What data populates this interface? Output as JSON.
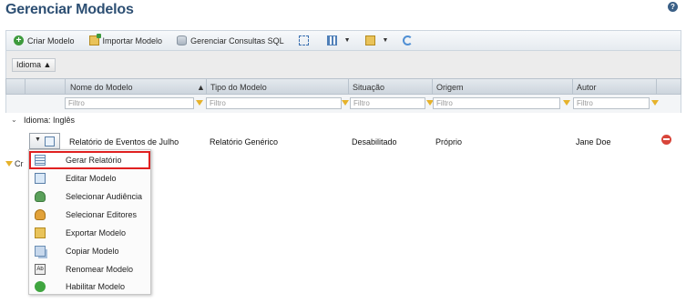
{
  "page": {
    "title": "Gerenciar Modelos"
  },
  "toolbar": {
    "create_label": "Criar Modelo",
    "import_label": "Importar Modelo",
    "sql_label": "Gerenciar Consultas SQL"
  },
  "grouping": {
    "chip_label": "Idioma"
  },
  "columns": {
    "name": "Nome do Modelo",
    "type": "Tipo do Modelo",
    "status": "Situação",
    "origin": "Origem",
    "author": "Autor"
  },
  "filter": {
    "placeholder": "Filtro"
  },
  "group": {
    "label": "Idioma: Inglês"
  },
  "row": {
    "name": "Relatório de Eventos de Julho",
    "type": "Relatório Genérico",
    "status": "Desabilitado",
    "origin": "Próprio",
    "author": "Jane Doe"
  },
  "footer": {
    "label": "Cr"
  },
  "context_menu": {
    "items": [
      {
        "label": "Gerar Relatório",
        "icon": "report-icon"
      },
      {
        "label": "Editar Modelo",
        "icon": "edit-icon"
      },
      {
        "label": "Selecionar Audiência",
        "icon": "audience-icon"
      },
      {
        "label": "Selecionar Editores",
        "icon": "editors-icon"
      },
      {
        "label": "Exportar Modelo",
        "icon": "export-icon"
      },
      {
        "label": "Copiar Modelo",
        "icon": "copy-icon"
      },
      {
        "label": "Renomear Modelo",
        "icon": "rename-icon"
      },
      {
        "label": "Habilitar Modelo",
        "icon": "enable-icon"
      }
    ]
  },
  "colors": {
    "title": "#2d4f73",
    "highlight_border": "#e02020",
    "filter_icon": "#e6b22b"
  }
}
